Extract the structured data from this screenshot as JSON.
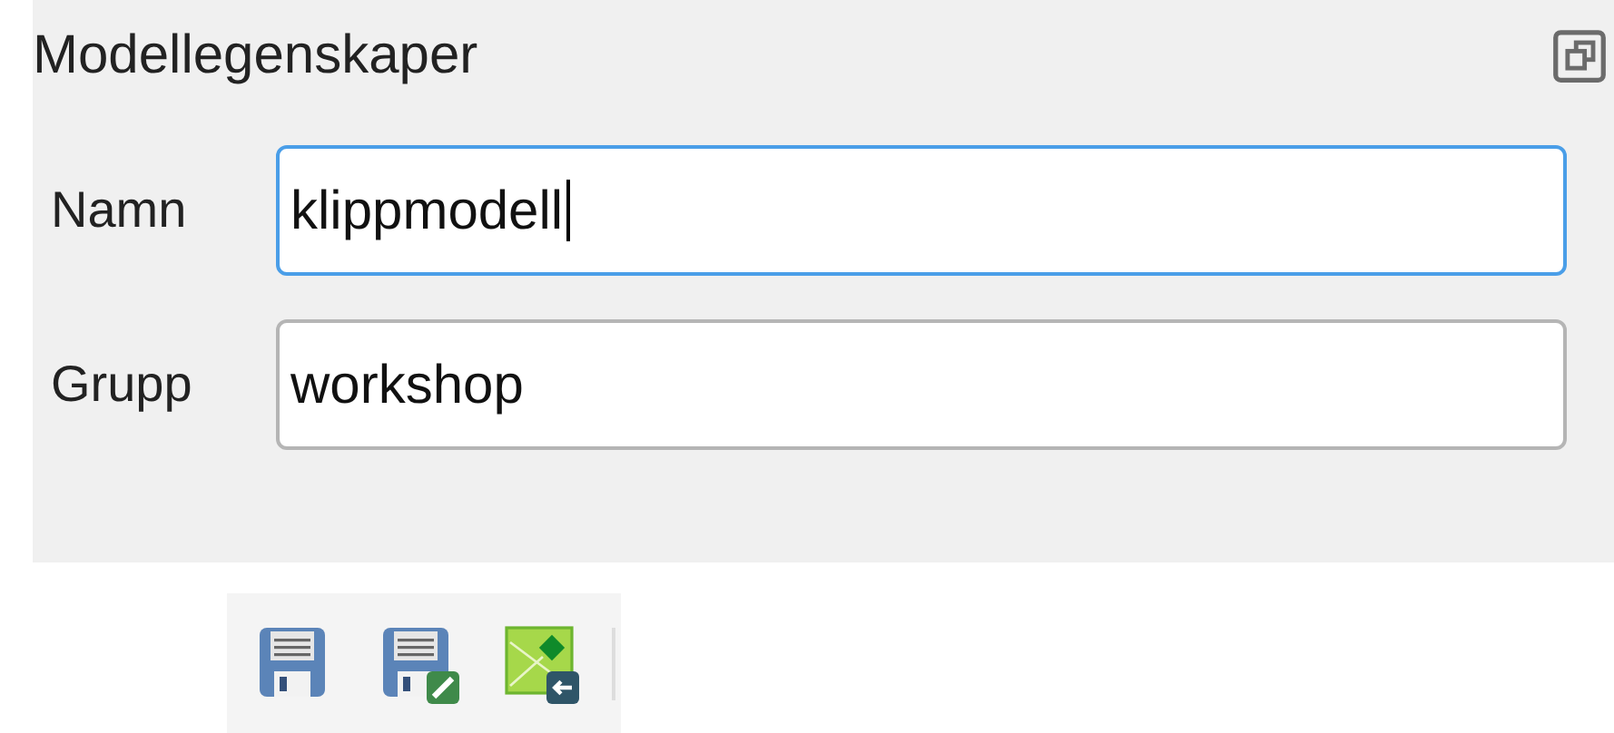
{
  "panel": {
    "title": "Modellegenskaper"
  },
  "fields": [
    {
      "label": "Namn",
      "value": "klippmodell",
      "focused": true
    },
    {
      "label": "Grupp",
      "value": "workshop",
      "focused": false
    }
  ]
}
